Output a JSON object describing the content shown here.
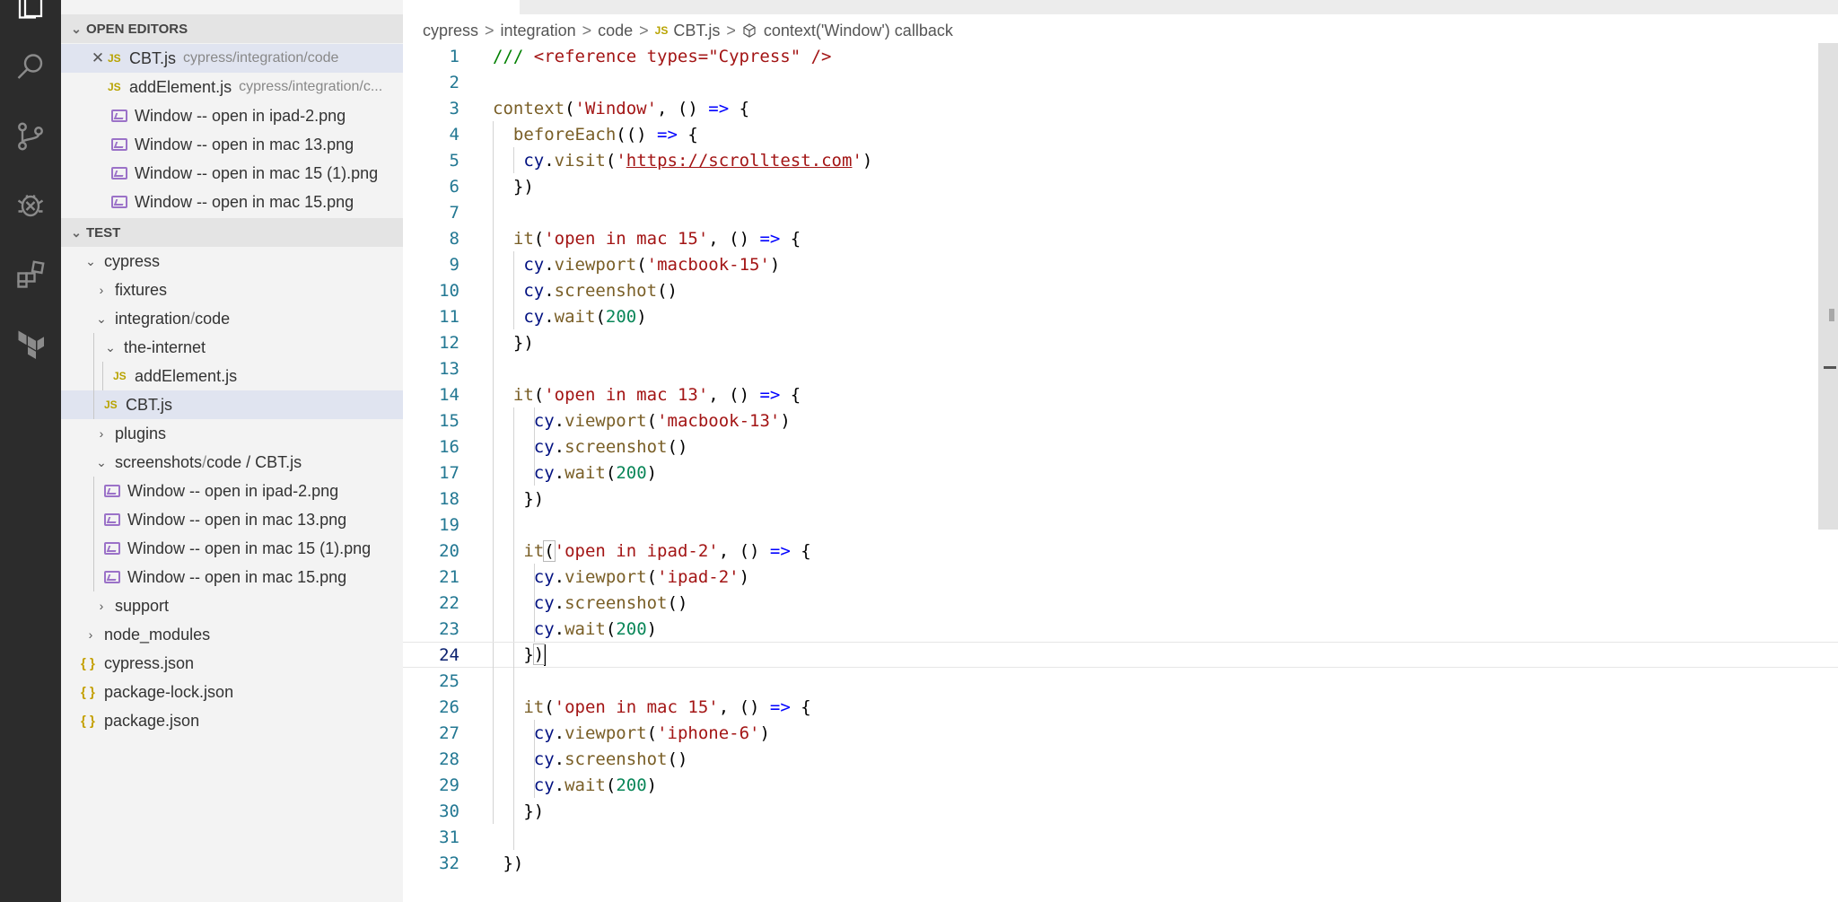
{
  "sidebar": {
    "open_editors_title": "OPEN EDITORS",
    "open_editors": [
      {
        "name": "CBT.js",
        "desc": "cypress/integration/code",
        "type": "js",
        "active": true
      },
      {
        "name": "addElement.js",
        "desc": "cypress/integration/c...",
        "type": "js"
      },
      {
        "name": "Window -- open in ipad-2.png",
        "type": "image"
      },
      {
        "name": "Window -- open in mac 13.png",
        "type": "image"
      },
      {
        "name": "Window -- open in mac 15 (1).png",
        "type": "image"
      },
      {
        "name": "Window -- open in mac 15.png",
        "type": "image"
      }
    ],
    "workspace_title": "TEST",
    "tree": [
      {
        "name": "cypress",
        "kind": "folder-open"
      },
      {
        "name": "fixtures",
        "kind": "folder-closed"
      },
      {
        "name": "integration",
        "name_sep": " / ",
        "name_tail": "code",
        "kind": "folder-open"
      },
      {
        "name": "the-internet",
        "kind": "folder-open"
      },
      {
        "name": "addElement.js",
        "kind": "js"
      },
      {
        "name": "CBT.js",
        "kind": "js"
      },
      {
        "name": "plugins",
        "kind": "folder-closed"
      },
      {
        "name": "screenshots",
        "name_sep": " / ",
        "name_tail": "code / CBT.js",
        "kind": "folder-open"
      },
      {
        "name": "Window -- open in ipad-2.png",
        "kind": "image"
      },
      {
        "name": "Window -- open in mac 13.png",
        "kind": "image"
      },
      {
        "name": "Window -- open in mac 15 (1).png",
        "kind": "image"
      },
      {
        "name": "Window -- open in mac 15.png",
        "kind": "image"
      },
      {
        "name": "support",
        "kind": "folder-closed"
      },
      {
        "name": "node_modules",
        "kind": "folder-closed"
      },
      {
        "name": "cypress.json",
        "kind": "json"
      },
      {
        "name": "package-lock.json",
        "kind": "json"
      },
      {
        "name": "package.json",
        "kind": "json"
      }
    ]
  },
  "breadcrumb": {
    "items": [
      "cypress",
      "integration",
      "code"
    ],
    "file": "CBT.js",
    "symbol": "context('Window') callback",
    "sep": ">"
  },
  "editor": {
    "line_numbers": [
      "1",
      "2",
      "3",
      "4",
      "5",
      "6",
      "7",
      "8",
      "9",
      "10",
      "11",
      "12",
      "13",
      "14",
      "15",
      "16",
      "17",
      "18",
      "19",
      "20",
      "21",
      "22",
      "23",
      "24",
      "25",
      "26",
      "27",
      "28",
      "29",
      "30",
      "31",
      "32"
    ],
    "current_line": "24",
    "tokens": {
      "l1_comment": "/// ",
      "l1_ref": "<reference types=\"Cypress\" />",
      "context": "context",
      "window_str": "'Window'",
      "arrow": "=>",
      "beforeEach": "beforeEach",
      "cy": "cy",
      "visit": "visit",
      "url_q1": "'",
      "url": "https://scrolltest.com",
      "url_q2": "'",
      "it": "it",
      "t_mac15": "'open in mac 15'",
      "t_mac13": "'open in mac 13'",
      "t_ipad2": "'open in ipad-2'",
      "viewport": "viewport",
      "screenshot": "screenshot",
      "wait": "wait",
      "v_mac15": "'macbook-15'",
      "v_mac13": "'macbook-13'",
      "v_ipad2": "'ipad-2'",
      "v_iphone6": "'iphone-6'",
      "n200": "200"
    }
  },
  "icons": {
    "activity": [
      "explorer-icon",
      "search-icon",
      "source-control-icon",
      "debug-icon",
      "extensions-icon",
      "terraform-icon"
    ]
  }
}
